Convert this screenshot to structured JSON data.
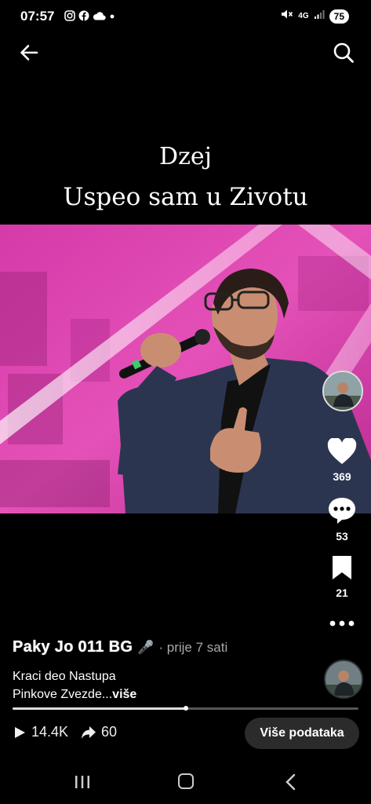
{
  "status_bar": {
    "time": "07:57",
    "network": "4G",
    "battery": "75",
    "left_icons": [
      "instagram-icon",
      "facebook-icon",
      "cloud-icon",
      "dot-icon"
    ],
    "right_icons": [
      "mute-icon",
      "signal-icon",
      "battery-icon"
    ]
  },
  "video": {
    "title_line1": "Dzej",
    "title_line2": "Uspeo sam u Zivotu",
    "progress": 0.5
  },
  "actions": {
    "likes": "369",
    "comments": "53",
    "saves": "21"
  },
  "post": {
    "author": "Paky Jo 011 BG",
    "author_emoji": "🎤",
    "time": "· prije 7 sati",
    "description_line1": "Kraci deo Nastupa",
    "description_line2": "Pinkove Zvezde...",
    "more_label": "više"
  },
  "stats": {
    "plays": "14.4K",
    "shares": "60",
    "details_button": "Više podataka"
  },
  "colors": {
    "background": "#000000",
    "stage_pink": "#d93bb0",
    "suit": "#2c3550"
  }
}
